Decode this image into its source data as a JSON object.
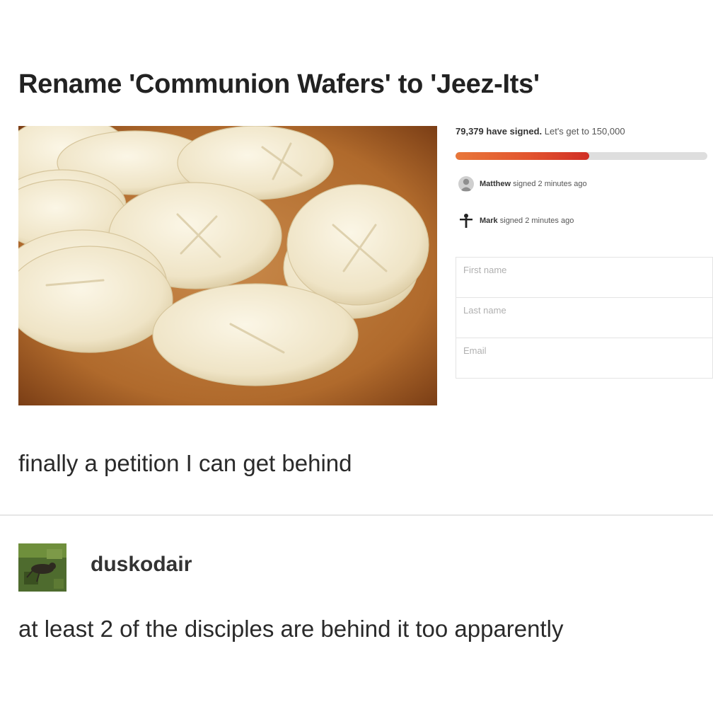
{
  "post": {
    "title": "Rename 'Communion Wafers' to 'Jeez-Its'",
    "caption": "finally a petition I can get behind"
  },
  "petition": {
    "signed_count": "79,379 have signed.",
    "goal_text": "Let's get to 150,000",
    "progress_fraction": 0.53,
    "signers": [
      {
        "name": "Matthew",
        "action": "signed 2 minutes ago",
        "icon": "person-icon"
      },
      {
        "name": "Mark",
        "action": "signed 2 minutes ago",
        "icon": "figure-icon"
      }
    ],
    "fields": {
      "first_name": "First name",
      "last_name": "Last name",
      "email": "Email"
    }
  },
  "reply": {
    "username": "duskodair",
    "text": "at least 2 of the disciples are behind it too apparently"
  },
  "colors": {
    "progress_start": "#e8773a",
    "progress_end": "#d02e25",
    "track": "#dedede"
  }
}
